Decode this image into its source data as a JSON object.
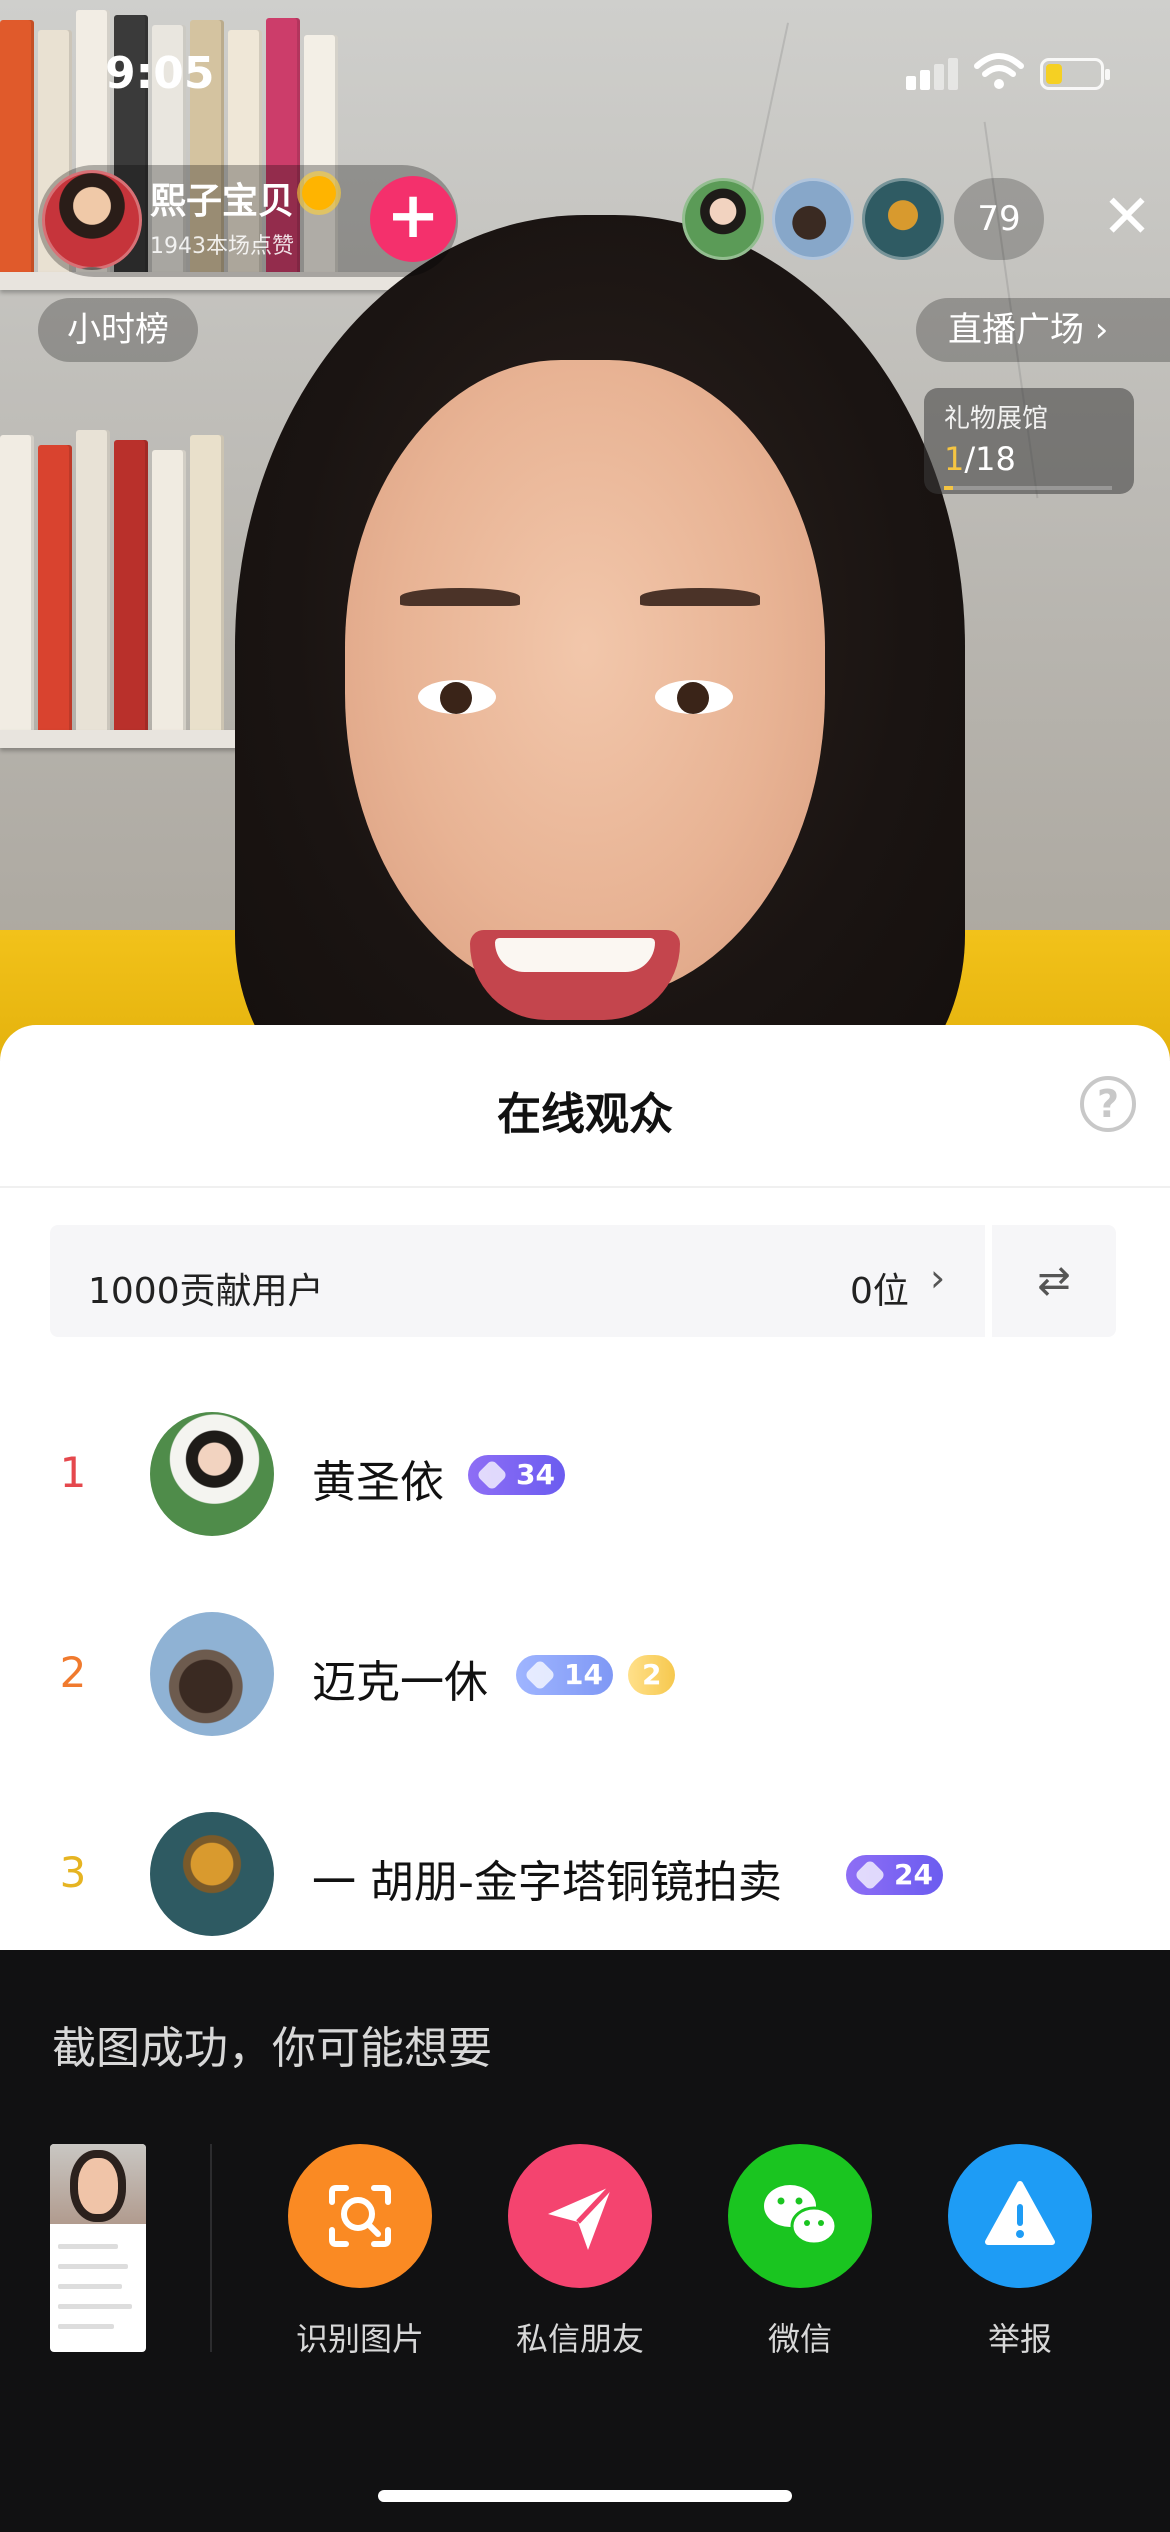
{
  "status_bar": {
    "time": "9:05"
  },
  "host": {
    "name": "熙子宝贝",
    "likes": "1943本场点赞",
    "follow_label": "+"
  },
  "top": {
    "viewer_count": "79",
    "close_label": "✕",
    "hour_rank": "小时榜",
    "live_plaza": "直播广场 ›"
  },
  "gift_gallery": {
    "title": "礼物展馆",
    "current": "1",
    "total": "/18",
    "progress": 0.0556
  },
  "sheet": {
    "title": "在线观众",
    "help_label": "?",
    "contrib_label": "1000贡献用户",
    "contrib_count": "0位",
    "contrib_chevron": "›",
    "switch_label": "⇄",
    "viewers": [
      {
        "rank": "1",
        "rank_color": "#e5484d",
        "name": "黄圣依",
        "badge": "34",
        "badge_style": "purple"
      },
      {
        "rank": "2",
        "rank_color": "#f07a2e",
        "name": "迈克一休",
        "badge": "14",
        "badge_style": "blue",
        "extra_badge": "2"
      },
      {
        "rank": "3",
        "rank_color": "#e6b422",
        "name": "一 胡朋-金字塔铜镜拍卖",
        "badge": "24",
        "badge_style": "purple"
      }
    ]
  },
  "screenshot_panel": {
    "title": "截图成功，你可能想要",
    "actions": [
      {
        "label": "识别图片",
        "icon": "scan-image-icon",
        "color": "#fa8a23"
      },
      {
        "label": "私信朋友",
        "icon": "send-icon",
        "color": "#f4446f"
      },
      {
        "label": "微信",
        "icon": "wechat-icon",
        "color": "#1ac520"
      },
      {
        "label": "举报",
        "icon": "warning-icon",
        "color": "#1e9cf5"
      }
    ]
  }
}
